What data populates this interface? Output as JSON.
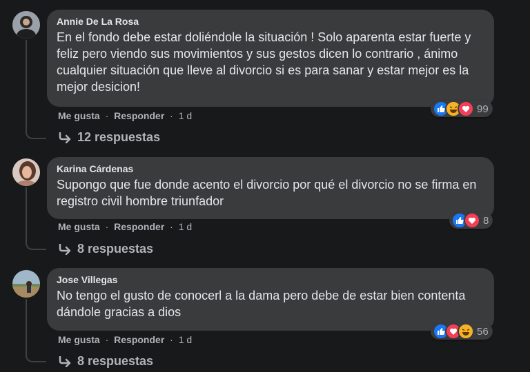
{
  "comments": [
    {
      "author": "Annie De La Rosa",
      "text": "En el fondo debe estar doliéndole la situación ! Solo aparenta estar fuerte y feliz pero viendo sus movimientos y sus gestos dicen lo contrario , ánimo cualquier situación que lleve al divorcio si es para sanar y estar mejor es la mejor desicion!",
      "like_label": "Me gusta",
      "reply_label": "Responder",
      "time": "1 d",
      "reactions": [
        "like-icon",
        "haha-icon",
        "love-icon"
      ],
      "reaction_count": "99",
      "replies_label": "12 respuestas"
    },
    {
      "author": "Karina Cárdenas",
      "text": "Supongo que fue donde acento el divorcio por qué el divorcio no se firma en registro civil hombre triunfador",
      "like_label": "Me gusta",
      "reply_label": "Responder",
      "time": "1 d",
      "reactions": [
        "like-icon",
        "love-icon"
      ],
      "reaction_count": "8",
      "replies_label": "8 respuestas"
    },
    {
      "author": "Jose Villegas",
      "text": "No tengo el gusto de conocerl a la dama pero debe de estar bien contenta dándole gracias a dios",
      "like_label": "Me gusta",
      "reply_label": "Responder",
      "time": "1 d",
      "reactions": [
        "like-icon",
        "love-icon",
        "haha-icon"
      ],
      "reaction_count": "56",
      "replies_label": "8 respuestas"
    }
  ],
  "separator": "·",
  "colors": {
    "background": "#18191a",
    "bubble": "#3a3b3c",
    "text": "#e4e6eb",
    "secondary_text": "#b0b3b8",
    "like": "#1877f2",
    "love": "#f33e58",
    "haha": "#f7b125"
  }
}
